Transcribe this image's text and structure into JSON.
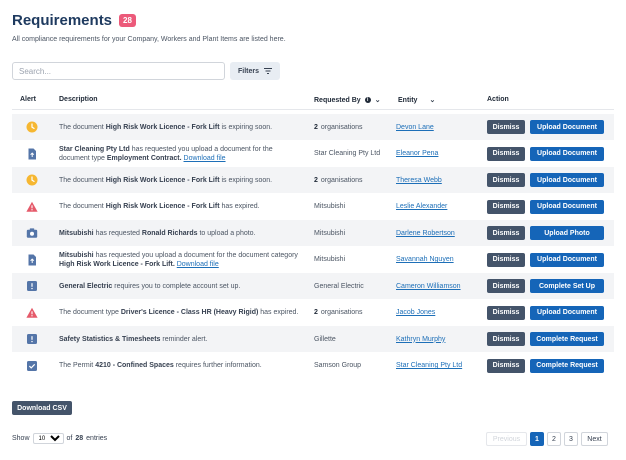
{
  "page": {
    "title": "Requirements",
    "count": "28",
    "subtitle": "All compliance requirements for your Company, Workers and Plant Items are listed here."
  },
  "toolbar": {
    "search_placeholder": "Search...",
    "filters_label": "Filters"
  },
  "table": {
    "headers": {
      "alert": "Alert",
      "description": "Description",
      "requested_by": "Requested By",
      "entity": "Entity",
      "action": "Action"
    },
    "rows": [
      {
        "icon": "clock-icon",
        "desc": [
          [
            "",
            "The document "
          ],
          [
            "b",
            "High Risk Work Licence - Fork Lift"
          ],
          [
            "",
            " is expiring soon."
          ]
        ],
        "req_count": "2",
        "req_text": "organisations",
        "entity": "Devon Lane",
        "dismiss": "Dismiss",
        "action": "Upload Document"
      },
      {
        "icon": "upload-file-icon",
        "desc": [
          [
            "b",
            "Star Cleaning Pty Ltd"
          ],
          [
            "",
            " has requested you upload a document for the document type "
          ],
          [
            "b",
            "Employment Contract."
          ],
          [
            "",
            " "
          ],
          [
            "a",
            "Download file"
          ]
        ],
        "req_count": "",
        "req_text": "Star Cleaning Pty Ltd",
        "entity": "Eleanor Pena",
        "dismiss": "Dismiss",
        "action": "Upload Document"
      },
      {
        "icon": "clock-icon",
        "desc": [
          [
            "",
            "The document "
          ],
          [
            "b",
            "High Risk Work Licence - Fork Lift"
          ],
          [
            "",
            " is expiring soon."
          ]
        ],
        "req_count": "2",
        "req_text": "organisations",
        "entity": "Theresa Webb",
        "dismiss": "Dismiss",
        "action": "Upload Document"
      },
      {
        "icon": "warning-icon",
        "desc": [
          [
            "",
            "The document "
          ],
          [
            "b",
            "High Risk Work Licence - Fork Lift"
          ],
          [
            "",
            " has expired."
          ]
        ],
        "req_count": "",
        "req_text": "Mitsubishi",
        "entity": "Leslie Alexander",
        "dismiss": "Dismiss",
        "action": "Upload Document"
      },
      {
        "icon": "camera-icon",
        "desc": [
          [
            "b",
            "Mitsubishi"
          ],
          [
            "",
            " has requested "
          ],
          [
            "b",
            "Ronald Richards"
          ],
          [
            "",
            " to upload a photo."
          ]
        ],
        "req_count": "",
        "req_text": "Mitsubishi",
        "entity": "Darlene Robertson",
        "dismiss": "Dismiss",
        "action": "Upload Photo"
      },
      {
        "icon": "upload-file-icon",
        "desc": [
          [
            "b",
            "Mitsubishi"
          ],
          [
            "",
            " has requested you upload a document for the document category "
          ],
          [
            "b",
            "High Risk Work Licence - Fork Lift."
          ],
          [
            "",
            " "
          ],
          [
            "a",
            "Download file"
          ]
        ],
        "req_count": "",
        "req_text": "Mitsubishi",
        "entity": "Savannah Nguyen",
        "dismiss": "Dismiss",
        "action": "Upload Document"
      },
      {
        "icon": "info-icon",
        "desc": [
          [
            "b",
            "General Electric"
          ],
          [
            "",
            " requires you to complete account set up."
          ]
        ],
        "req_count": "",
        "req_text": "General Electric",
        "entity": "Cameron Williamson",
        "dismiss": "Dismiss",
        "action": "Complete Set Up"
      },
      {
        "icon": "warning-icon",
        "desc": [
          [
            "",
            "The document type "
          ],
          [
            "b",
            "Driver's Licence - Class HR (Heavy Rigid)"
          ],
          [
            "",
            " has expired."
          ]
        ],
        "req_count": "2",
        "req_text": "organisations",
        "entity": "Jacob Jones",
        "dismiss": "Dismiss",
        "action": "Upload Document"
      },
      {
        "icon": "info-icon",
        "desc": [
          [
            "b",
            "Safety Statistics & Timesheets"
          ],
          [
            "",
            " reminder alert."
          ]
        ],
        "req_count": "",
        "req_text": "Gillette",
        "entity": "Kathryn Murphy",
        "dismiss": "Dismiss",
        "action": "Complete Request"
      },
      {
        "icon": "checkbox-icon",
        "desc": [
          [
            "",
            "The Permit "
          ],
          [
            "b",
            "4210 - Confined Spaces"
          ],
          [
            "",
            " requires further information."
          ]
        ],
        "req_count": "",
        "req_text": "Samson Group",
        "entity": "Star Cleaning Pty Ltd",
        "dismiss": "Dismiss",
        "action": "Complete Request"
      }
    ]
  },
  "download_csv": "Download CSV",
  "footer": {
    "show_label": "Show",
    "page_size": "10",
    "of_label": "of",
    "total": "28",
    "entries_label": "entries"
  },
  "pagination": {
    "previous": "Previous",
    "pages": [
      "1",
      "2",
      "3"
    ],
    "next": "Next",
    "current": "1"
  },
  "colors": {
    "accent": "#1565b8",
    "dismiss": "#44546a",
    "badge": "#ec5a7a",
    "clock": "#f6b731",
    "warning": "#e55a6a",
    "icon_blue": "#5475a8"
  }
}
